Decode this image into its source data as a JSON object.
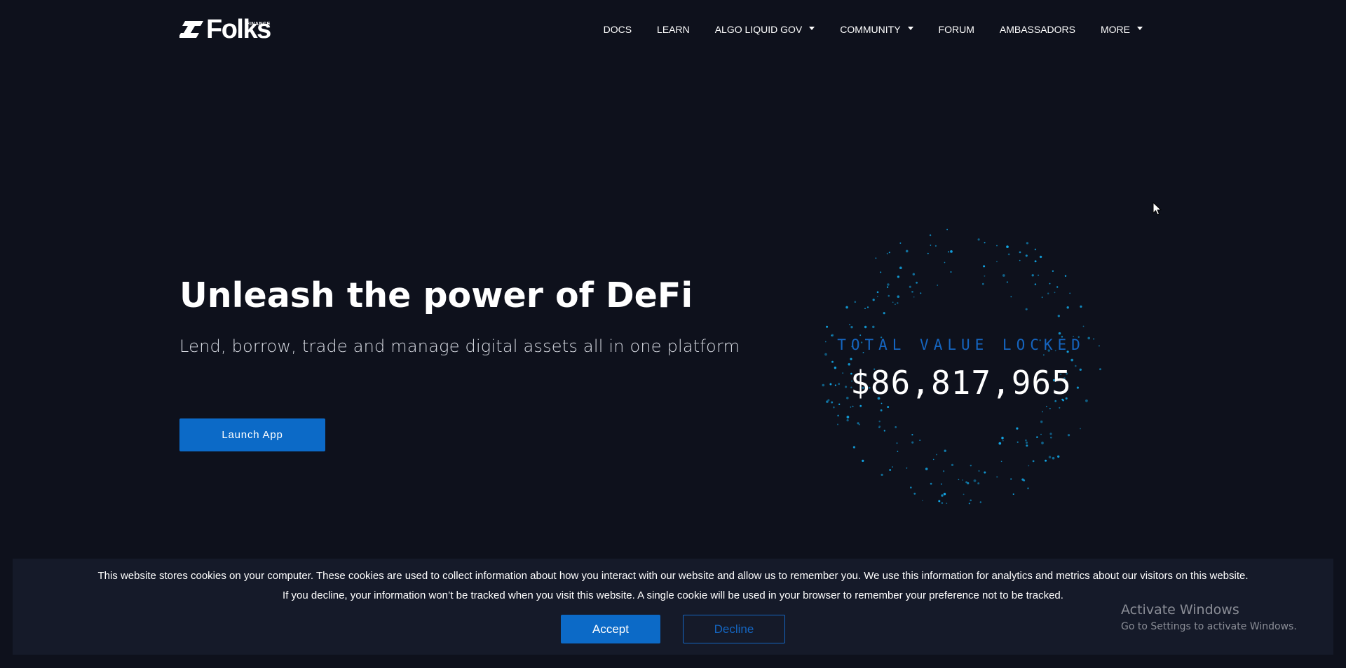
{
  "header": {
    "logo_text": "Folks",
    "logo_subtext": "FINANCE",
    "nav": [
      {
        "label": "DOCS",
        "has_dropdown": false
      },
      {
        "label": "LEARN",
        "has_dropdown": false
      },
      {
        "label": "ALGO LIQUID GOV",
        "has_dropdown": true
      },
      {
        "label": "COMMUNITY",
        "has_dropdown": true
      },
      {
        "label": "FORUM",
        "has_dropdown": false
      },
      {
        "label": "AMBASSADORS",
        "has_dropdown": false
      },
      {
        "label": "MORE",
        "has_dropdown": true
      }
    ]
  },
  "hero": {
    "title": "Unleash the power of DeFi",
    "subtitle": "Lend, borrow, trade and manage digital assets all in one platform",
    "cta_label": "Launch App"
  },
  "tvl": {
    "label": "TOTAL VALUE LOCKED",
    "value": "$86,817,965"
  },
  "cookie_banner": {
    "line1": "This website stores cookies on your computer. These cookies are used to collect information about how you interact with our website and allow us to remember you. We use this information for analytics and metrics about our visitors on this website.",
    "line2": "If you decline, your information won’t be tracked when you visit this website. A single cookie will be used in your browser to remember your preference not to be tracked.",
    "accept_label": "Accept",
    "decline_label": "Decline"
  },
  "watermark": {
    "title": "Activate Windows",
    "subtitle": "Go to Settings to activate Windows."
  },
  "colors": {
    "background": "#0e111c",
    "accent": "#0c6ac7",
    "tvl_label": "#1565c0",
    "particle": "#12a8e8",
    "banner": "#151a29"
  },
  "icons": {
    "logo": "folks-finance-logo-icon",
    "dropdown": "caret-down-icon",
    "cursor": "mouse-pointer-icon"
  }
}
